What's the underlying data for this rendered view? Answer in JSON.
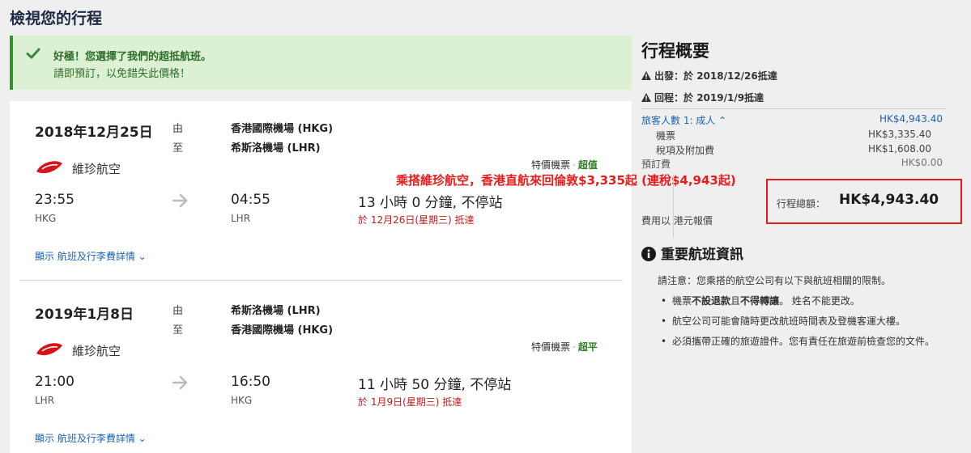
{
  "page": {
    "title": "檢視您的行程"
  },
  "alert": {
    "line1": "好極！您選擇了我們的超抵航班。",
    "line2": "請即預訂，以免錯失此價格！"
  },
  "legs": [
    {
      "date": "2018年12月25日",
      "from_label": "由",
      "to_label": "至",
      "from_airport": "香港國際機場 (HKG)",
      "to_airport": "希斯洛機場 (LHR)",
      "airline": "維珍航空",
      "fare_type": "特價機票",
      "fare_tag": "超值",
      "depart_time": "23:55",
      "depart_code": "HKG",
      "arrive_time": "04:55",
      "arrive_code": "LHR",
      "duration": "13 小時 0 分鐘, 不停站",
      "arrive_note": "於 12月26日(星期三) 抵達",
      "details_link": "顯示 航班及行李費詳情"
    },
    {
      "date": "2019年1月8日",
      "from_label": "由",
      "to_label": "至",
      "from_airport": "希斯洛機場 (LHR)",
      "to_airport": "香港國際機場 (HKG)",
      "airline": "維珍航空",
      "fare_type": "特價機票",
      "fare_tag": "超平",
      "depart_time": "21:00",
      "depart_code": "LHR",
      "arrive_time": "16:50",
      "arrive_code": "HKG",
      "duration": "11 小時 50 分鐘, 不停站",
      "arrive_note": "於 1月9日(星期三) 抵達",
      "details_link": "顯示 航班及行李費詳情"
    }
  ],
  "promo_annotation": "乘搭維珍航空，香港直航來回倫敦$3,335起 (連稅$4,943起)",
  "summary": {
    "title": "行程概要",
    "outbound": {
      "label": "出發：",
      "value": "於 2018/12/26抵達"
    },
    "return": {
      "label": "回程：",
      "value": "於 2019/1/9抵達"
    },
    "travelers": {
      "label": "旅客人數 1: 成人",
      "value": "HK$4,943.40"
    },
    "ticket": {
      "label": "機票",
      "value": "HK$3,335.40"
    },
    "taxes": {
      "label": "稅項及附加費",
      "value": "HK$1,608.00"
    },
    "booking_fee": {
      "label": "預訂費",
      "value": "HK$0.00"
    },
    "total": {
      "label": "行程總額：",
      "value": "HK$4,943.40"
    },
    "currency_note": "費用以 港元報價"
  },
  "important": {
    "title": "重要航班資訊",
    "intro": "請注意：您乘搭的航空公司有以下與航班相關的限制。",
    "item1": {
      "pre": "機票",
      "bold1": "不設退款",
      "mid": "且",
      "bold2": "不得轉讓",
      "post": "。 姓名不能更改。"
    },
    "item2": "航空公司可能會隨時更改航班時間表及登機客運大樓。",
    "item3": "必須攜帶正確的旅遊證件。您有責任在旅遊前檢查您的文件。"
  },
  "colors": {
    "alert_bg": "#dcf0d4",
    "alert_accent": "#3c8a34",
    "link": "#1d63b0",
    "promo": "#e81c1c",
    "arrive_note": "#c11a1a"
  }
}
